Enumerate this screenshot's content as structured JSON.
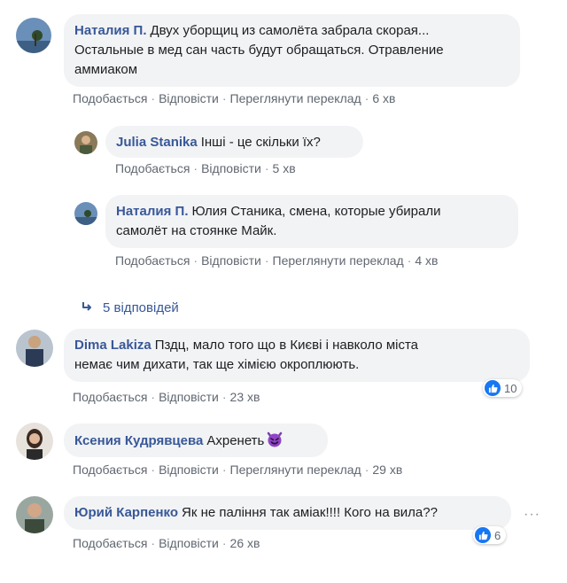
{
  "comments": {
    "c1": {
      "author": "Наталия П.",
      "text_line1": "Двух уборщиц из самолёта забрала скорая...",
      "text_line2": "Остальные в мед сан часть будут обращаться. Отравление",
      "text_line3": "аммиаком",
      "like": "Подобається",
      "reply": "Відповісти",
      "translate": "Переглянути переклад",
      "time": "6 хв"
    },
    "c2": {
      "author": "Julia Stanika",
      "text": "Інші - це скільки їх?",
      "like": "Подобається",
      "reply": "Відповісти",
      "time": "5 хв"
    },
    "c3": {
      "author": "Наталия П.",
      "text_line1": "Юлия Станика, смена, которые убирали",
      "text_line2": "самолёт на стоянке Майк.",
      "like": "Подобається",
      "reply": "Відповісти",
      "translate": "Переглянути переклад",
      "time": "4 хв"
    },
    "replies": {
      "label": "5 відповідей"
    },
    "c4": {
      "author": "Dima Lakiza",
      "text_line1": "Пздц, мало того що в Києві і навколо міста",
      "text_line2": "немає чим дихати, так ще хімією окроплюють.",
      "like": "Подобається",
      "reply": "Відповісти",
      "time": "23 хв",
      "reactions": "10"
    },
    "c5": {
      "author": "Ксения Кудрявцева",
      "text": "Ахренеть",
      "like": "Подобається",
      "reply": "Відповісти",
      "translate": "Переглянути переклад",
      "time": "29 хв"
    },
    "c6": {
      "author": "Юрий Карпенко",
      "text": "Як не паління так аміак!!!! Кого на вила??",
      "like": "Подобається",
      "reply": "Відповісти",
      "time": "26 хв",
      "reactions": "6",
      "more": "···"
    }
  },
  "colors": {
    "bubble": "#f2f3f5",
    "author": "#385898",
    "meta": "#606770",
    "like_blue": "#1877f2"
  },
  "icons": [
    "like-icon",
    "reply-arrow-icon",
    "devil-emoji-icon",
    "more-options-icon"
  ]
}
